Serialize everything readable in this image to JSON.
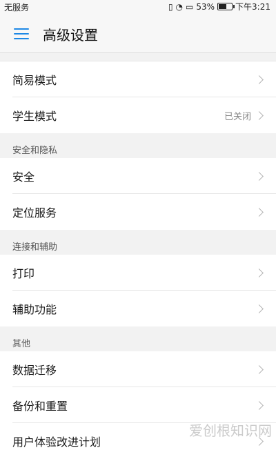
{
  "status_bar": {
    "carrier": "无服务",
    "battery_text": "53%",
    "battery_level": 0.53,
    "time": "下午3:21",
    "icons": [
      "vibrate-icon",
      "wifi-icon",
      "sim-icon",
      "battery-icon"
    ]
  },
  "header": {
    "title": "高级设置",
    "menu_icon": "hamburger-menu-icon",
    "accent_color": "#1e88e5"
  },
  "rows_top": [
    {
      "label": "简易模式",
      "value": ""
    },
    {
      "label": "学生模式",
      "value": "已关闭"
    }
  ],
  "sections": [
    {
      "title": "安全和隐私",
      "items": [
        {
          "label": "安全"
        },
        {
          "label": "定位服务"
        }
      ]
    },
    {
      "title": "连接和辅助",
      "items": [
        {
          "label": "打印"
        },
        {
          "label": "辅助功能"
        }
      ]
    },
    {
      "title": "其他",
      "items": [
        {
          "label": "数据迁移"
        },
        {
          "label": "备份和重置"
        },
        {
          "label": "用户体验改进计划"
        }
      ]
    }
  ],
  "watermark": "爱创根知识网"
}
